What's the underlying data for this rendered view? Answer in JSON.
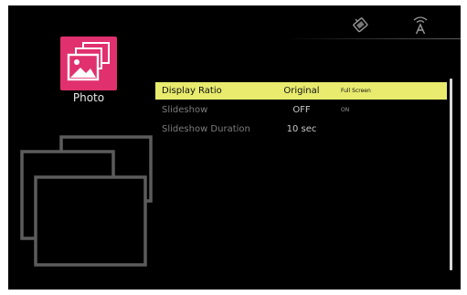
{
  "status_bar": {
    "icons": [
      "tv-tuner-icon",
      "wifi-antenna-icon"
    ]
  },
  "sidebar": {
    "category_icon": "photo-icon",
    "category_label": "Photo"
  },
  "settings": [
    {
      "label": "Display Ratio",
      "value": "Original",
      "alt_option": "Full Screen",
      "selected": true
    },
    {
      "label": "Slideshow",
      "value": "OFF",
      "alt_option": "ON",
      "selected": false
    },
    {
      "label": "Slideshow Duration",
      "value": "10 sec",
      "alt_option": "",
      "selected": false
    }
  ],
  "colors": {
    "selection": "#e8eb6d",
    "accent_tile": "#e0316e",
    "background": "#000000"
  }
}
